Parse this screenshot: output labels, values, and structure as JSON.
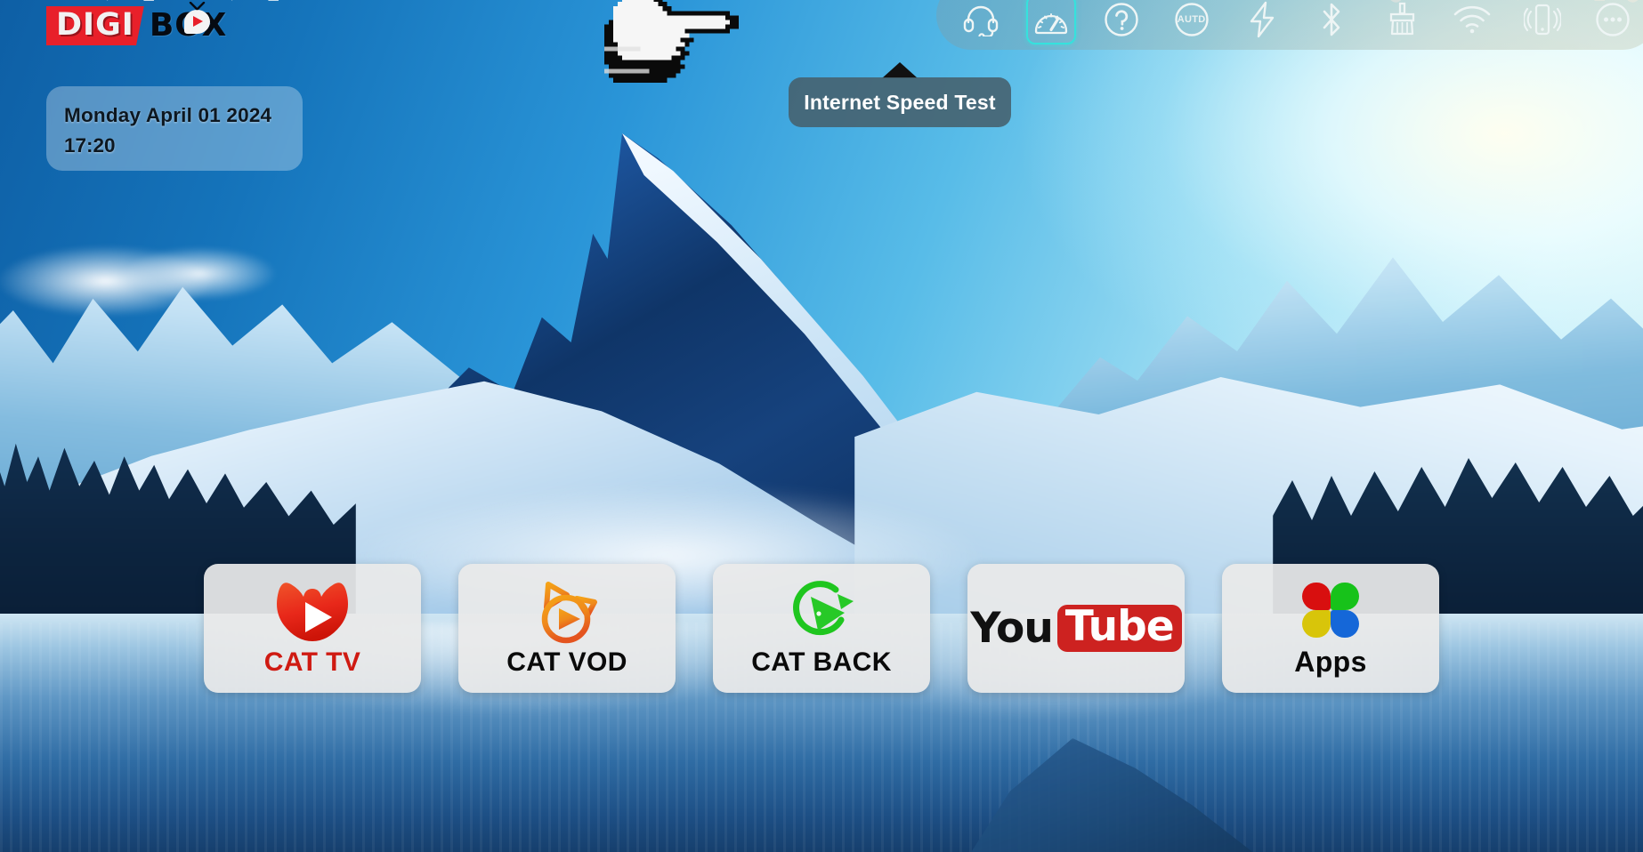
{
  "app": {
    "name": "DIGIBOX",
    "logo": {
      "primary": "DIGI",
      "secondary": "BOX",
      "primary_bg": "#e8202a",
      "secondary_color": "#050a12"
    }
  },
  "status_strip": {
    "glyphs": [
      "▼",
      "■",
      "▼",
      "■",
      "⬤",
      "▼",
      "■",
      "⬤"
    ]
  },
  "date_widget": {
    "date": "Monday April 01 2024",
    "time": "17:20"
  },
  "iconbar": {
    "items": [
      {
        "label": "Support",
        "icon": "headset-icon",
        "selected": false
      },
      {
        "label": "Internet Speed Test",
        "icon": "speedometer-icon",
        "selected": true
      },
      {
        "label": "Help",
        "icon": "question-mark-icon",
        "selected": false
      },
      {
        "label": "AUTD",
        "icon": "autd-icon",
        "selected": false,
        "text": "AUTD"
      },
      {
        "label": "Power Boost",
        "icon": "lightning-bolt-icon",
        "selected": false
      },
      {
        "label": "Bluetooth",
        "icon": "bluetooth-icon",
        "selected": false
      },
      {
        "label": "Clean",
        "icon": "broom-icon",
        "selected": false
      },
      {
        "label": "Wi-Fi",
        "icon": "wifi-icon",
        "selected": false
      },
      {
        "label": "Remote",
        "icon": "phone-vibrate-icon",
        "selected": false
      },
      {
        "label": "More",
        "icon": "more-dots-icon",
        "selected": false
      }
    ]
  },
  "tooltip": {
    "text": "Internet Speed Test",
    "bg": "#46606c"
  },
  "cursor": {
    "type": "pointing-hand-cursor"
  },
  "dock": {
    "apps": [
      {
        "label": "CAT TV",
        "icon": "cat-tv-icon",
        "label_color": "#cf1a12"
      },
      {
        "label": "CAT VOD",
        "icon": "cat-vod-icon",
        "label_color": "#0a0a0a"
      },
      {
        "label": "CAT BACK",
        "icon": "cat-back-icon",
        "label_color": "#0a0a0a"
      },
      {
        "label": "YouTube",
        "icon": "youtube-icon",
        "label_color": "#0a0a0a",
        "wordmark": {
          "first": "You",
          "second": "Tube",
          "second_bg": "#cd2220"
        }
      },
      {
        "label": "Apps",
        "icon": "apps-flower-icon",
        "label_color": "#0a0a0a"
      }
    ]
  },
  "colors": {
    "accent_selected": "#35e2dd",
    "brand_red": "#e8202a",
    "cat_tv_red": "#e8391c",
    "cat_vod_orange": "#f29219",
    "cat_back_green": "#1fc61f",
    "youtube_red": "#cd2220",
    "dock_tile": "#eaeaea"
  }
}
